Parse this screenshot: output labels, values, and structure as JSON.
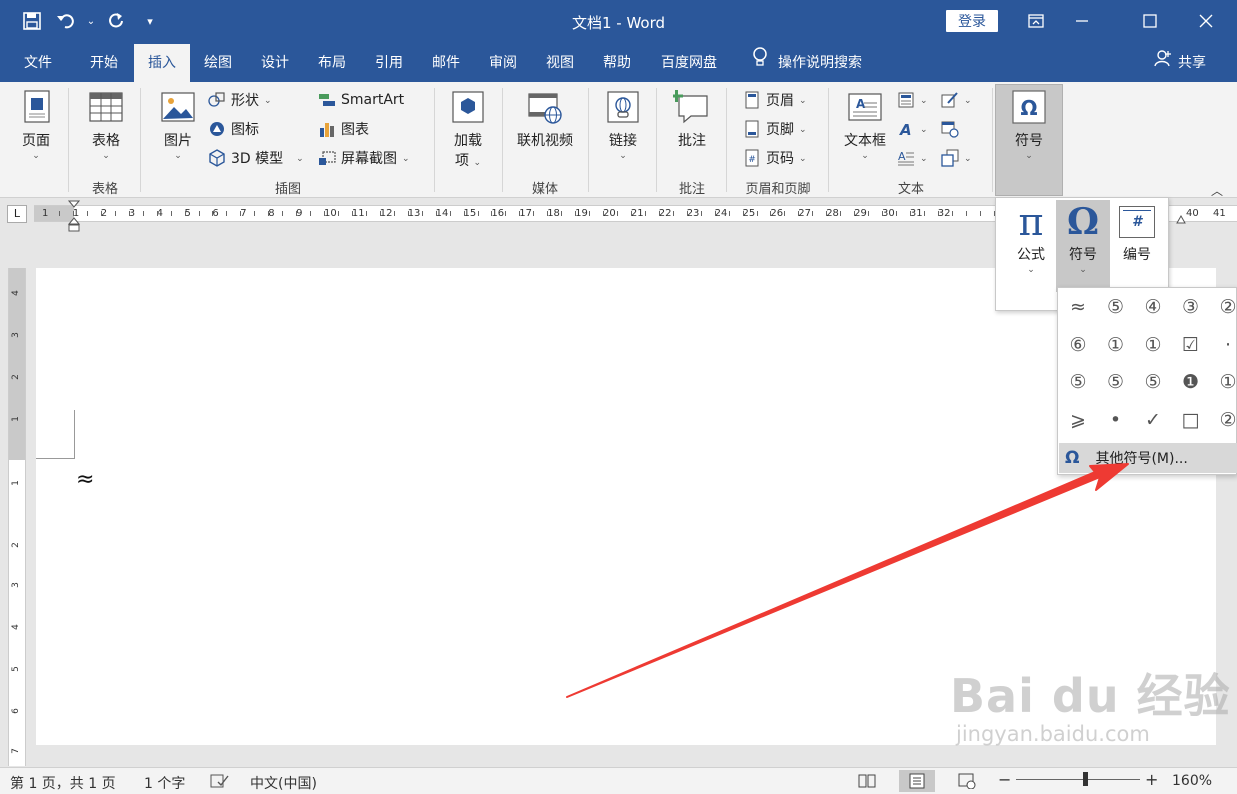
{
  "window": {
    "title": "文档1  -  Word",
    "login": "登录"
  },
  "tabs": [
    "文件",
    "开始",
    "插入",
    "绘图",
    "设计",
    "布局",
    "引用",
    "邮件",
    "审阅",
    "视图",
    "帮助",
    "百度网盘"
  ],
  "tell_me": "操作说明搜索",
  "share": "共享",
  "ribbon": {
    "pages": {
      "btn": "页面",
      "caret": "⌄"
    },
    "tables": {
      "btn": "表格",
      "caret": "⌄",
      "label": "表格"
    },
    "illustrations": {
      "picture": "图片",
      "caret": "⌄",
      "shapes": "形状",
      "icons": "图标",
      "model3d": "3D 模型",
      "smartart": "SmartArt",
      "chart": "图表",
      "screenshot": "屏幕截图",
      "label": "插图"
    },
    "addins": {
      "btn1": "加载",
      "btn2": "项",
      "caret": "⌄"
    },
    "media": {
      "btn": "联机视频",
      "label": "媒体"
    },
    "links": {
      "btn": "链接",
      "caret": "⌄"
    },
    "comments": {
      "btn": "批注",
      "label": "批注"
    },
    "header_footer": {
      "header": "页眉",
      "footer": "页脚",
      "page_number": "页码",
      "label": "页眉和页脚"
    },
    "text": {
      "textbox": "文本框",
      "caret": "⌄",
      "label": "文本"
    },
    "symbols": {
      "btn": "符号",
      "caret": "⌄",
      "glyph": "Ω"
    }
  },
  "ruler": {
    "corner": "L",
    "h_numbers": [
      "1",
      "1",
      "2",
      "3",
      "4",
      "5",
      "6",
      "7",
      "8",
      "9",
      "10",
      "11",
      "12",
      "13",
      "14",
      "15",
      "16",
      "17",
      "18",
      "19",
      "20",
      "21",
      "22",
      "23",
      "24",
      "25",
      "26",
      "27",
      "28",
      "29",
      "30",
      "31",
      "32",
      "40",
      "41"
    ],
    "v_numbers": [
      "4",
      "3",
      "2",
      "1",
      "1",
      "2",
      "3",
      "4",
      "5",
      "6",
      "7"
    ]
  },
  "document": {
    "content": "≈"
  },
  "symbols_menu": {
    "equation": {
      "glyph": "π",
      "label": "公式",
      "caret": "⌄"
    },
    "symbol": {
      "glyph": "Ω",
      "label": "符号",
      "caret": "⌄"
    },
    "numbering": {
      "glyph": "#",
      "label": "编号"
    },
    "grid": [
      [
        "≈",
        "⑤",
        "④",
        "③",
        "②"
      ],
      [
        "⑥",
        "①",
        "①",
        "☑",
        "·"
      ],
      [
        "⑤",
        "⑤",
        "⑤",
        "❶",
        "①"
      ],
      [
        "⩾",
        "•",
        "✓",
        "□",
        "②"
      ]
    ],
    "more": "其他符号(M)..."
  },
  "watermark": {
    "brand": "Bai du 经验",
    "url": "jingyan.baidu.com"
  },
  "statusbar": {
    "page": "第 1 页，共 1 页",
    "words": "1 个字",
    "language": "中文(中国)",
    "zoom_minus": "−",
    "zoom_plus": "+",
    "zoom": "160%"
  }
}
